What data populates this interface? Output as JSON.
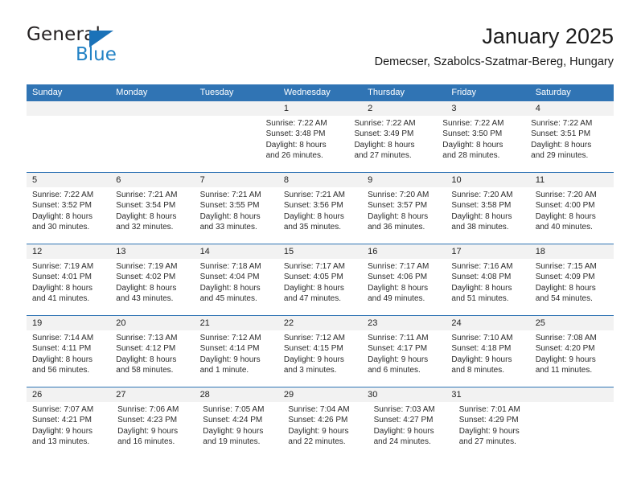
{
  "brand": {
    "name_part1": "General",
    "name_part2": "Blue",
    "triangle_icon": "triangle-icon",
    "colors": {
      "dark": "#231f20",
      "blue": "#2282c5",
      "triangle": "#1b72b8"
    }
  },
  "header": {
    "title": "January 2025",
    "subtitle": "Demecser, Szabolcs-Szatmar-Bereg, Hungary"
  },
  "theme": {
    "header_blue": "#3074b4",
    "date_strip_gray": "#f2f2f2",
    "body_white": "#ffffff",
    "text": "#2b2b2b"
  },
  "weekdays": [
    "Sunday",
    "Monday",
    "Tuesday",
    "Wednesday",
    "Thursday",
    "Friday",
    "Saturday"
  ],
  "weeks": [
    {
      "days": [
        {
          "date": "",
          "lines": []
        },
        {
          "date": "",
          "lines": []
        },
        {
          "date": "",
          "lines": []
        },
        {
          "date": "1",
          "lines": [
            "Sunrise: 7:22 AM",
            "Sunset: 3:48 PM",
            "Daylight: 8 hours",
            "and 26 minutes."
          ]
        },
        {
          "date": "2",
          "lines": [
            "Sunrise: 7:22 AM",
            "Sunset: 3:49 PM",
            "Daylight: 8 hours",
            "and 27 minutes."
          ]
        },
        {
          "date": "3",
          "lines": [
            "Sunrise: 7:22 AM",
            "Sunset: 3:50 PM",
            "Daylight: 8 hours",
            "and 28 minutes."
          ]
        },
        {
          "date": "4",
          "lines": [
            "Sunrise: 7:22 AM",
            "Sunset: 3:51 PM",
            "Daylight: 8 hours",
            "and 29 minutes."
          ]
        }
      ]
    },
    {
      "days": [
        {
          "date": "5",
          "lines": [
            "Sunrise: 7:22 AM",
            "Sunset: 3:52 PM",
            "Daylight: 8 hours",
            "and 30 minutes."
          ]
        },
        {
          "date": "6",
          "lines": [
            "Sunrise: 7:21 AM",
            "Sunset: 3:54 PM",
            "Daylight: 8 hours",
            "and 32 minutes."
          ]
        },
        {
          "date": "7",
          "lines": [
            "Sunrise: 7:21 AM",
            "Sunset: 3:55 PM",
            "Daylight: 8 hours",
            "and 33 minutes."
          ]
        },
        {
          "date": "8",
          "lines": [
            "Sunrise: 7:21 AM",
            "Sunset: 3:56 PM",
            "Daylight: 8 hours",
            "and 35 minutes."
          ]
        },
        {
          "date": "9",
          "lines": [
            "Sunrise: 7:20 AM",
            "Sunset: 3:57 PM",
            "Daylight: 8 hours",
            "and 36 minutes."
          ]
        },
        {
          "date": "10",
          "lines": [
            "Sunrise: 7:20 AM",
            "Sunset: 3:58 PM",
            "Daylight: 8 hours",
            "and 38 minutes."
          ]
        },
        {
          "date": "11",
          "lines": [
            "Sunrise: 7:20 AM",
            "Sunset: 4:00 PM",
            "Daylight: 8 hours",
            "and 40 minutes."
          ]
        }
      ]
    },
    {
      "days": [
        {
          "date": "12",
          "lines": [
            "Sunrise: 7:19 AM",
            "Sunset: 4:01 PM",
            "Daylight: 8 hours",
            "and 41 minutes."
          ]
        },
        {
          "date": "13",
          "lines": [
            "Sunrise: 7:19 AM",
            "Sunset: 4:02 PM",
            "Daylight: 8 hours",
            "and 43 minutes."
          ]
        },
        {
          "date": "14",
          "lines": [
            "Sunrise: 7:18 AM",
            "Sunset: 4:04 PM",
            "Daylight: 8 hours",
            "and 45 minutes."
          ]
        },
        {
          "date": "15",
          "lines": [
            "Sunrise: 7:17 AM",
            "Sunset: 4:05 PM",
            "Daylight: 8 hours",
            "and 47 minutes."
          ]
        },
        {
          "date": "16",
          "lines": [
            "Sunrise: 7:17 AM",
            "Sunset: 4:06 PM",
            "Daylight: 8 hours",
            "and 49 minutes."
          ]
        },
        {
          "date": "17",
          "lines": [
            "Sunrise: 7:16 AM",
            "Sunset: 4:08 PM",
            "Daylight: 8 hours",
            "and 51 minutes."
          ]
        },
        {
          "date": "18",
          "lines": [
            "Sunrise: 7:15 AM",
            "Sunset: 4:09 PM",
            "Daylight: 8 hours",
            "and 54 minutes."
          ]
        }
      ]
    },
    {
      "days": [
        {
          "date": "19",
          "lines": [
            "Sunrise: 7:14 AM",
            "Sunset: 4:11 PM",
            "Daylight: 8 hours",
            "and 56 minutes."
          ]
        },
        {
          "date": "20",
          "lines": [
            "Sunrise: 7:13 AM",
            "Sunset: 4:12 PM",
            "Daylight: 8 hours",
            "and 58 minutes."
          ]
        },
        {
          "date": "21",
          "lines": [
            "Sunrise: 7:12 AM",
            "Sunset: 4:14 PM",
            "Daylight: 9 hours",
            "and 1 minute."
          ]
        },
        {
          "date": "22",
          "lines": [
            "Sunrise: 7:12 AM",
            "Sunset: 4:15 PM",
            "Daylight: 9 hours",
            "and 3 minutes."
          ]
        },
        {
          "date": "23",
          "lines": [
            "Sunrise: 7:11 AM",
            "Sunset: 4:17 PM",
            "Daylight: 9 hours",
            "and 6 minutes."
          ]
        },
        {
          "date": "24",
          "lines": [
            "Sunrise: 7:10 AM",
            "Sunset: 4:18 PM",
            "Daylight: 9 hours",
            "and 8 minutes."
          ]
        },
        {
          "date": "25",
          "lines": [
            "Sunrise: 7:08 AM",
            "Sunset: 4:20 PM",
            "Daylight: 9 hours",
            "and 11 minutes."
          ]
        }
      ]
    },
    {
      "days": [
        {
          "date": "26",
          "lines": [
            "Sunrise: 7:07 AM",
            "Sunset: 4:21 PM",
            "Daylight: 9 hours",
            "and 13 minutes."
          ]
        },
        {
          "date": "27",
          "lines": [
            "Sunrise: 7:06 AM",
            "Sunset: 4:23 PM",
            "Daylight: 9 hours",
            "and 16 minutes."
          ]
        },
        {
          "date": "28",
          "lines": [
            "Sunrise: 7:05 AM",
            "Sunset: 4:24 PM",
            "Daylight: 9 hours",
            "and 19 minutes."
          ]
        },
        {
          "date": "29",
          "lines": [
            "Sunrise: 7:04 AM",
            "Sunset: 4:26 PM",
            "Daylight: 9 hours",
            "and 22 minutes."
          ]
        },
        {
          "date": "30",
          "lines": [
            "Sunrise: 7:03 AM",
            "Sunset: 4:27 PM",
            "Daylight: 9 hours",
            "and 24 minutes."
          ]
        },
        {
          "date": "31",
          "lines": [
            "Sunrise: 7:01 AM",
            "Sunset: 4:29 PM",
            "Daylight: 9 hours",
            "and 27 minutes."
          ]
        },
        {
          "date": "",
          "lines": []
        }
      ]
    }
  ]
}
